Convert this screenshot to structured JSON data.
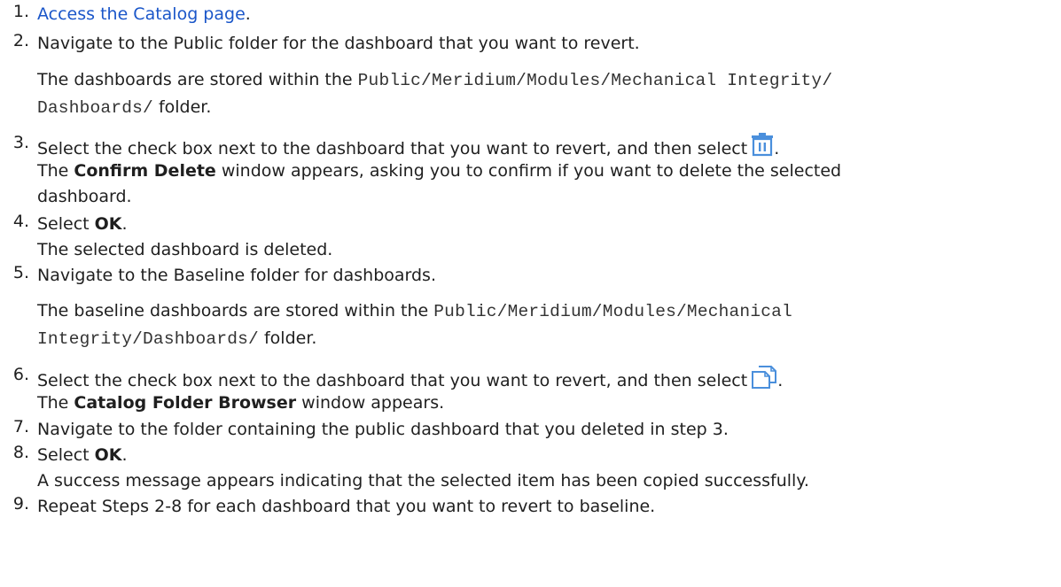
{
  "steps": [
    {
      "num": "1.",
      "link_text": "Access the Catalog page",
      "after": "."
    },
    {
      "num": "2.",
      "text": "Navigate to the Public folder for the dashboard that you want to revert.",
      "note_prefix": "The dashboards are stored within the ",
      "path_line1": "Public/Meridium/Modules/Mechanical Integrity/",
      "path_line2": "Dashboards/",
      "note_suffix": " folder."
    },
    {
      "num": "3.",
      "text": "Select the check box next to the dashboard that you want to revert, and then select",
      "after_icon": ".",
      "icon": "trash-icon",
      "result_prefix": "The ",
      "result_bold": "Confirm Delete",
      "result_suffix_line1": " window appears, asking you to confirm if you want to delete the selected",
      "result_line2": "dashboard."
    },
    {
      "num": "4.",
      "prefix": "Select ",
      "bold": "OK",
      "suffix": ".",
      "result": "The selected dashboard is deleted."
    },
    {
      "num": "5.",
      "text": "Navigate to the Baseline folder for dashboards.",
      "note_prefix": "The baseline dashboards are stored within the ",
      "path_line1": "Public/Meridium/Modules/Mechanical",
      "path_line2": "Integrity/Dashboards/",
      "note_suffix": " folder."
    },
    {
      "num": "6.",
      "text": "Select the check box next to the dashboard that you want to revert, and then select",
      "after_icon": ".",
      "icon": "copy-icon",
      "result_prefix": "The ",
      "result_bold": "Catalog Folder Browser",
      "result_suffix": " window appears."
    },
    {
      "num": "7.",
      "text": "Navigate to the folder containing the public dashboard that you deleted in step 3."
    },
    {
      "num": "8.",
      "prefix": "Select ",
      "bold": "OK",
      "suffix": ".",
      "result": "A success message appears indicating that the selected item has been copied successfully."
    },
    {
      "num": "9.",
      "text": "Repeat Steps 2-8 for each dashboard that you want to revert to baseline."
    }
  ],
  "colors": {
    "link": "#1a56c9",
    "icon": "#4a8fdc",
    "text": "#1f1f1f"
  }
}
